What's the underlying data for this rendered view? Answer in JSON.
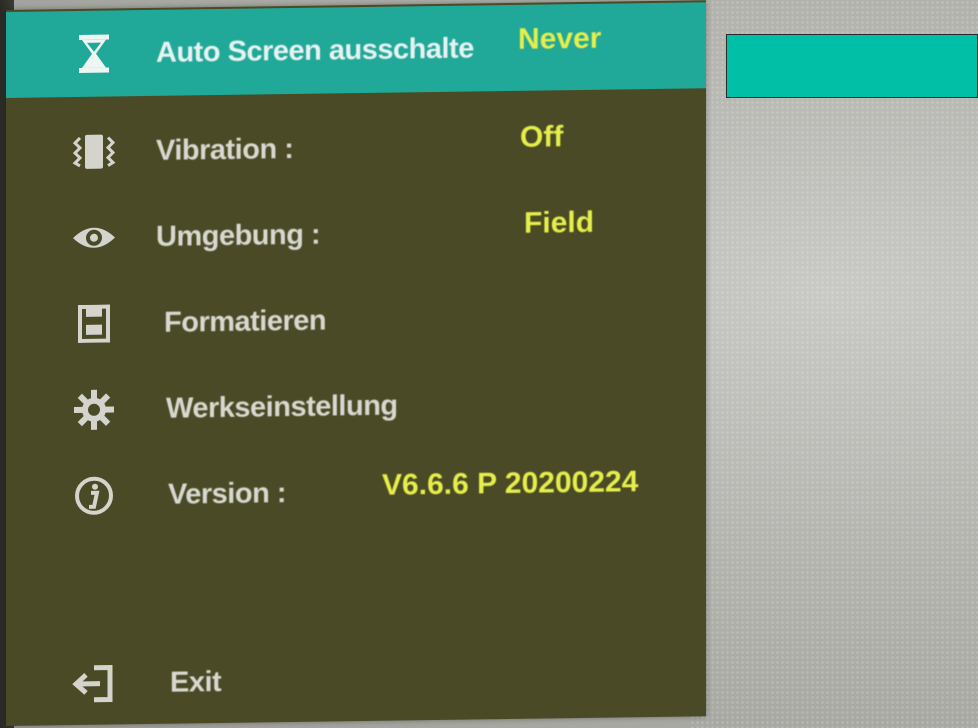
{
  "menu": {
    "items": [
      {
        "label": "Auto Screen ausschalte",
        "value": "Never",
        "icon": "hourglass-icon",
        "selected": true
      },
      {
        "label": "Vibration :",
        "value": "Off",
        "icon": "vibration-icon"
      },
      {
        "label": "Umgebung :",
        "value": "Field",
        "icon": "eye-icon"
      },
      {
        "label": "Formatieren",
        "value": "",
        "icon": "storage-card-icon"
      },
      {
        "label": "Werkseinstellung",
        "value": "",
        "icon": "gear-icon"
      },
      {
        "label": "Version :",
        "value": "V6.6.6 P 20200224",
        "icon": "info-icon"
      }
    ],
    "exit_label": "Exit",
    "exit_icon": "exit-icon"
  },
  "colors": {
    "panel": "#4a4a26",
    "highlight": "#20a898",
    "value_text": "#e6ee4a",
    "value_button": "#00bfa6"
  }
}
